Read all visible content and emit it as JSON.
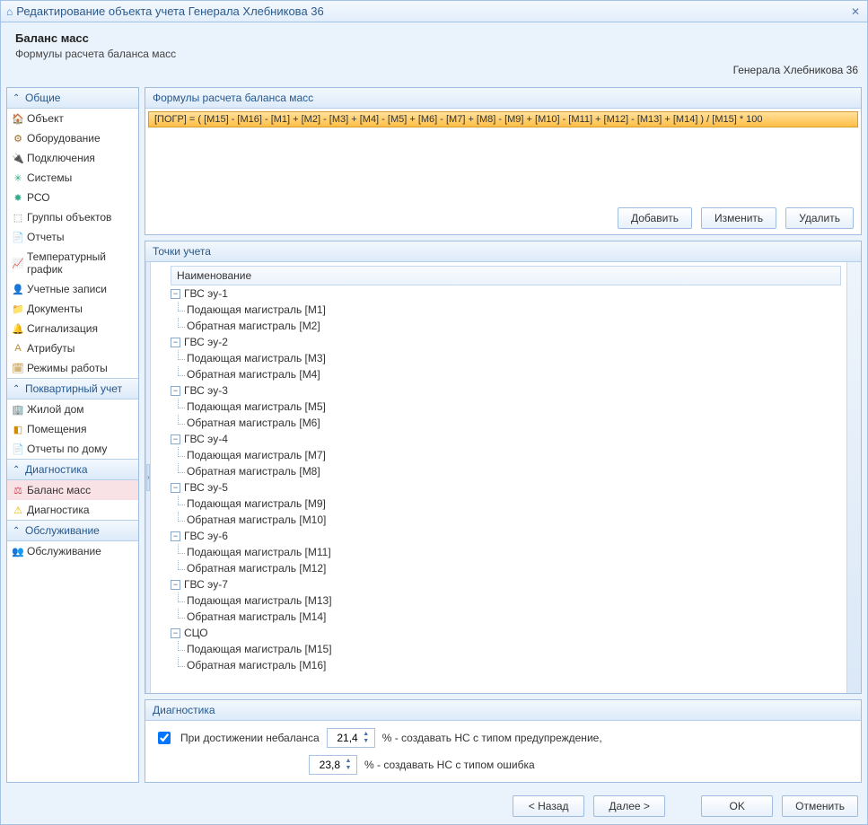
{
  "window_title": "Редактирование объекта учета Генерала Хлебникова 36",
  "header": {
    "title": "Баланс масс",
    "subtitle": "Формулы расчета баланса масс",
    "right": "Генерала Хлебникова 36"
  },
  "sidebar": {
    "sections": [
      {
        "label": "Общие",
        "items": [
          {
            "label": "Объект",
            "icon": "🏠",
            "cls": "ic-home"
          },
          {
            "label": "Оборудование",
            "icon": "⚙",
            "cls": "ic-gear"
          },
          {
            "label": "Подключения",
            "icon": "🔌",
            "cls": "ic-plug"
          },
          {
            "label": "Системы",
            "icon": "✳",
            "cls": "ic-globe"
          },
          {
            "label": "РСО",
            "icon": "✸",
            "cls": "ic-globe"
          },
          {
            "label": "Группы объектов",
            "icon": "⬚",
            "cls": "ic-db"
          },
          {
            "label": "Отчеты",
            "icon": "📄",
            "cls": "ic-report"
          },
          {
            "label": "Температурный график",
            "icon": "📈",
            "cls": "ic-report"
          },
          {
            "label": "Учетные записи",
            "icon": "👤",
            "cls": "ic-user"
          },
          {
            "label": "Документы",
            "icon": "📁",
            "cls": "ic-doc"
          },
          {
            "label": "Сигнализация",
            "icon": "🔔",
            "cls": "ic-bell"
          },
          {
            "label": "Атрибуты",
            "icon": "A",
            "cls": "ic-report"
          },
          {
            "label": "Режимы работы",
            "icon": "🗓",
            "cls": "ic-report"
          }
        ]
      },
      {
        "label": "Поквартирный учет",
        "items": [
          {
            "label": "Жилой дом",
            "icon": "🏢",
            "cls": "ic-db"
          },
          {
            "label": "Помещения",
            "icon": "◧",
            "cls": "ic-room"
          },
          {
            "label": "Отчеты по дому",
            "icon": "📄",
            "cls": "ic-report"
          }
        ]
      },
      {
        "label": "Диагностика",
        "items": [
          {
            "label": "Баланс масс",
            "icon": "⚖",
            "cls": "ic-mass",
            "selected": true
          },
          {
            "label": "Диагностика",
            "icon": "⚠",
            "cls": "ic-alert"
          }
        ]
      },
      {
        "label": "Обслуживание",
        "items": [
          {
            "label": "Обслуживание",
            "icon": "👥",
            "cls": "ic-user"
          }
        ]
      }
    ]
  },
  "formula_panel": {
    "title": "Формулы расчета баланса масс",
    "formula": "[ПОГР] = ( [M15] - [M16] - [M1] + [M2] - [M3] + [M4] - [M5] + [M6] - [M7] + [M8] - [M9] + [M10] - [M11] + [M12] - [M13] + [M14] ) / [M15] * 100",
    "buttons": {
      "add": "Добавить",
      "edit": "Изменить",
      "delete": "Удалить"
    }
  },
  "points_panel": {
    "title": "Точки учета",
    "header_col": "Наименование",
    "groups": [
      {
        "name": "ГВС эу-1",
        "children": [
          {
            "t": "Подающая магистраль [M1]"
          },
          {
            "t": "Обратная магистраль [M2]"
          }
        ]
      },
      {
        "name": "ГВС эу-2",
        "children": [
          {
            "t": "Подающая магистраль [M3]"
          },
          {
            "t": "Обратная магистраль [M4]"
          }
        ]
      },
      {
        "name": "ГВС эу-3",
        "children": [
          {
            "t": "Подающая магистраль [M5]"
          },
          {
            "t": "Обратная магистраль [M6]"
          }
        ]
      },
      {
        "name": "ГВС эу-4",
        "children": [
          {
            "t": "Подающая магистраль [M7]"
          },
          {
            "t": "Обратная магистраль [M8]"
          }
        ]
      },
      {
        "name": "ГВС эу-5",
        "children": [
          {
            "t": "Подающая магистраль [M9]"
          },
          {
            "t": "Обратная магистраль [M10]"
          }
        ]
      },
      {
        "name": "ГВС эу-6",
        "children": [
          {
            "t": "Подающая магистраль [M11]"
          },
          {
            "t": "Обратная магистраль [M12]"
          }
        ]
      },
      {
        "name": "ГВС эу-7",
        "children": [
          {
            "t": "Подающая магистраль [M13]"
          },
          {
            "t": "Обратная магистраль [M14]"
          }
        ]
      },
      {
        "name": "СЦО",
        "children": [
          {
            "t": "Подающая магистраль [M15]"
          },
          {
            "t": "Обратная магистраль [M16]"
          }
        ]
      }
    ]
  },
  "diag_panel": {
    "title": "Диагностика",
    "checkbox_label": "При достижении небаланса",
    "warning_value": "21,4",
    "warning_suffix": "% - создавать НС с типом предупреждение,",
    "error_value": "23,8",
    "error_suffix": "% - создавать НС с типом ошибка"
  },
  "footer": {
    "back": "< Назад",
    "next": "Далее >",
    "ok": "OK",
    "cancel": "Отменить"
  }
}
